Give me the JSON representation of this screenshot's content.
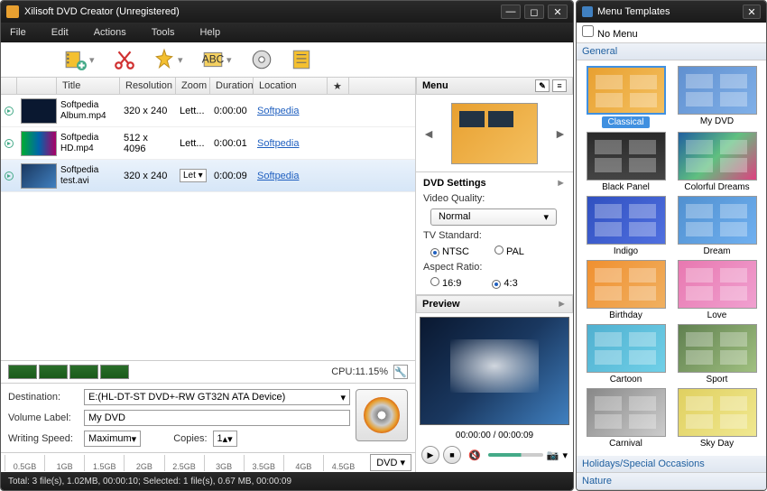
{
  "window": {
    "title": "Xilisoft DVD Creator (Unregistered)"
  },
  "menubar": {
    "file": "File",
    "edit": "Edit",
    "actions": "Actions",
    "tools": "Tools",
    "help": "Help"
  },
  "table": {
    "headers": {
      "title": "Title",
      "resolution": "Resolution",
      "zoom": "Zoom",
      "duration": "Duration",
      "location": "Location",
      "star": "★"
    },
    "rows": [
      {
        "title": "Softpedia Album.mp4",
        "res": "320 x 240",
        "zoom": "Lett...",
        "dur": "0:00:00",
        "loc": "Softpedia"
      },
      {
        "title": "Softpedia HD.mp4",
        "res": "512 x 4096",
        "zoom": "Lett...",
        "dur": "0:00:01",
        "loc": "Softpedia"
      },
      {
        "title": "Softpedia test.avi",
        "res": "320 x 240",
        "zoom": "Let",
        "dur": "0:00:09",
        "loc": "Softpedia"
      }
    ]
  },
  "cpu": {
    "label": "CPU:11.15%"
  },
  "dest": {
    "destination_label": "Destination:",
    "destination_value": "E:(HL-DT-ST DVD+-RW GT32N ATA Device)",
    "volume_label": "Volume Label:",
    "volume_value": "My DVD",
    "speed_label": "Writing Speed:",
    "speed_value": "Maximum",
    "copies_label": "Copies:",
    "copies_value": "1"
  },
  "ruler": {
    "ticks": [
      "0.5GB",
      "1GB",
      "1.5GB",
      "2GB",
      "2.5GB",
      "3GB",
      "3.5GB",
      "4GB",
      "4.5GB"
    ],
    "dvd": "DVD"
  },
  "statusbar": "Total: 3 file(s), 1.02MB,  00:00:10; Selected: 1 file(s), 0.67 MB,  00:00:09",
  "menu_panel": {
    "header": "Menu"
  },
  "dvd_settings": {
    "header": "DVD Settings",
    "quality_label": "Video Quality:",
    "quality_value": "Normal",
    "tv_label": "TV Standard:",
    "ntsc": "NTSC",
    "pal": "PAL",
    "aspect_label": "Aspect Ratio:",
    "r169": "16:9",
    "r43": "4:3"
  },
  "preview": {
    "header": "Preview",
    "time": "00:00:00 / 00:00:09"
  },
  "templates": {
    "title": "Menu Templates",
    "nomenu": "No Menu",
    "cat_general": "General",
    "cat_holidays": "Holidays/Special Occasions",
    "cat_nature": "Nature",
    "items": [
      {
        "name": "Classical",
        "bg": "linear-gradient(135deg,#e8a030,#f4c060)"
      },
      {
        "name": "My DVD",
        "bg": "linear-gradient(135deg,#6090d0,#80b0e8)"
      },
      {
        "name": "Black Panel",
        "bg": "linear-gradient(#2a2a2a,#444)"
      },
      {
        "name": "Colorful Dreams",
        "bg": "linear-gradient(135deg,#2060a0,#60c080,#e04080)"
      },
      {
        "name": "Indigo",
        "bg": "linear-gradient(135deg,#3050c0,#5070e0)"
      },
      {
        "name": "Dream",
        "bg": "linear-gradient(135deg,#5090d0,#70b0f0)"
      },
      {
        "name": "Birthday",
        "bg": "linear-gradient(135deg,#f09030,#f0b060)"
      },
      {
        "name": "Love",
        "bg": "linear-gradient(135deg,#e878b0,#f0a0d0)"
      },
      {
        "name": "Cartoon",
        "bg": "linear-gradient(135deg,#50b0d0,#70d0e8)"
      },
      {
        "name": "Sport",
        "bg": "linear-gradient(135deg,#608050,#a0c080)"
      },
      {
        "name": "Carnival",
        "bg": "linear-gradient(135deg,#888,#ccc)"
      },
      {
        "name": "Sky Day",
        "bg": "linear-gradient(135deg,#e0d060,#f0e890)"
      }
    ]
  }
}
